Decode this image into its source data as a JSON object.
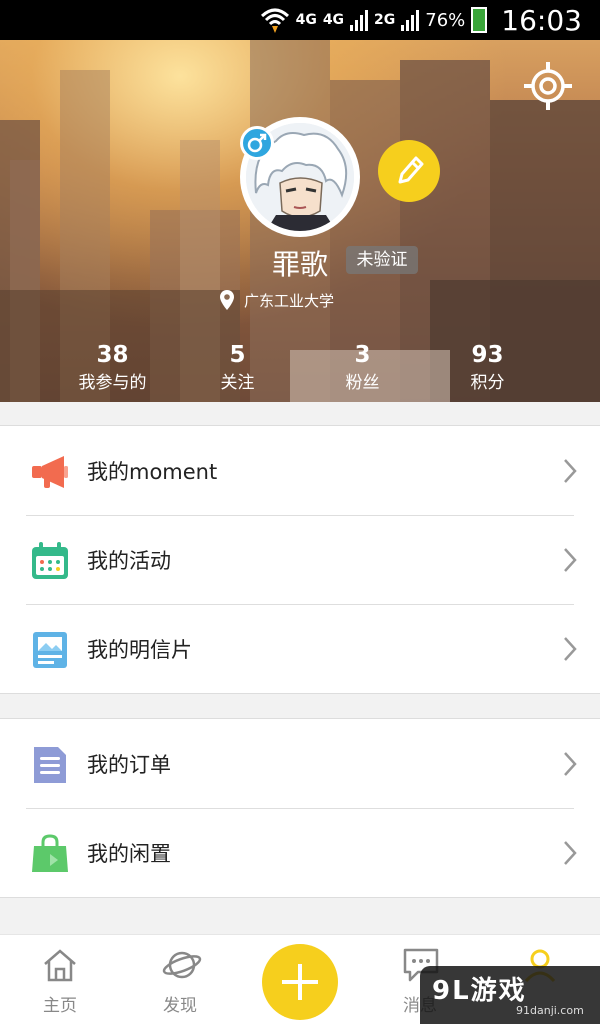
{
  "status_bar": {
    "network_1": "4G",
    "network_2": "4G",
    "network_3": "2G",
    "battery": "76%",
    "time": "16:03"
  },
  "profile": {
    "name": "罪歌",
    "verify_status": "未验证",
    "school": "广东工业大学",
    "stats": [
      {
        "value": "38",
        "label": "我参与的"
      },
      {
        "value": "5",
        "label": "关注"
      },
      {
        "value": "3",
        "label": "粉丝"
      },
      {
        "value": "93",
        "label": "积分"
      }
    ]
  },
  "menu_group_1": [
    {
      "label": "我的moment",
      "icon": "megaphone-icon"
    },
    {
      "label": "我的活动",
      "icon": "calendar-icon"
    },
    {
      "label": "我的明信片",
      "icon": "postcard-icon"
    }
  ],
  "menu_group_2": [
    {
      "label": "我的订单",
      "icon": "order-doc-icon"
    },
    {
      "label": "我的闲置",
      "icon": "shopping-bag-icon"
    }
  ],
  "tab_bar": {
    "tabs": [
      {
        "label": "主页",
        "icon": "home-icon"
      },
      {
        "label": "发现",
        "icon": "planet-icon"
      },
      {
        "label": "消息",
        "icon": "chat-bubble-icon"
      },
      {
        "label": "",
        "icon": "profile-icon"
      }
    ],
    "center_action": "plus-icon"
  },
  "watermark": {
    "main": "9L游戏",
    "sub": "91danji.com"
  },
  "colors": {
    "accent_yellow": "#f6cf1d",
    "gender_blue": "#2fa6df",
    "megaphone": "#f26b4f",
    "calendar": "#34b98a",
    "postcard": "#5fb3e6",
    "order": "#8e9bd6",
    "bag": "#5cc96a"
  }
}
